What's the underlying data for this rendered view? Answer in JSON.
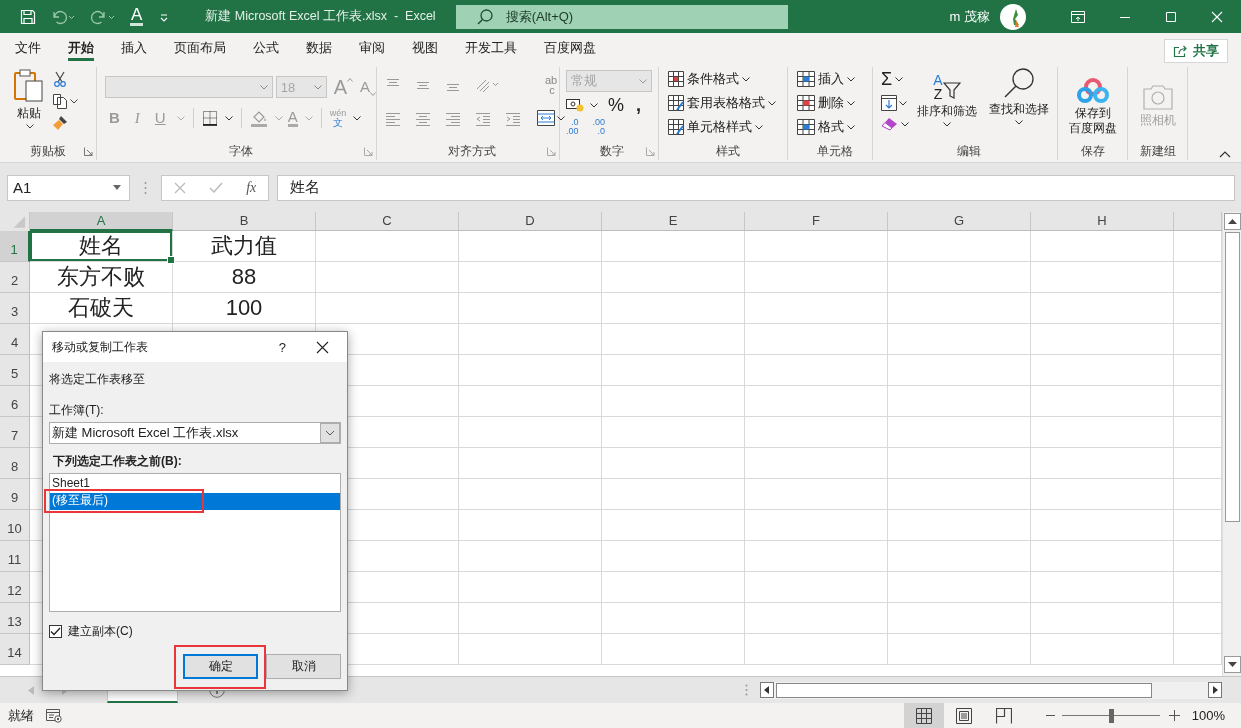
{
  "title_bar": {
    "font_color_glyph": "A",
    "title": "新建 Microsoft Excel 工作表.xlsx  -  Excel",
    "search": {
      "placeholder": "搜索(Alt+Q)"
    },
    "user_name": "m 茂稼"
  },
  "menu_tabs": [
    {
      "label": "文件",
      "selected": false
    },
    {
      "label": "开始",
      "selected": true
    },
    {
      "label": "插入",
      "selected": false
    },
    {
      "label": "页面布局",
      "selected": false
    },
    {
      "label": "公式",
      "selected": false
    },
    {
      "label": "数据",
      "selected": false
    },
    {
      "label": "审阅",
      "selected": false
    },
    {
      "label": "视图",
      "selected": false
    },
    {
      "label": "开发工具",
      "selected": false
    },
    {
      "label": "百度网盘",
      "selected": false
    }
  ],
  "share_button": "共享",
  "ribbon": {
    "clipboard": {
      "label": "剪贴板",
      "paste": "粘贴"
    },
    "font": {
      "label": "字体",
      "disabled": true,
      "font_size": "18",
      "grow_glyph": "A",
      "shrink_glyph": "A",
      "bold": "B",
      "italic": "I",
      "underline": "U",
      "color_glyph": "A",
      "phonetic": "wén",
      "phonetic_char": "文"
    },
    "alignment": {
      "label": "对齐方式",
      "wrap_glyphs": [
        "ab",
        "c"
      ]
    },
    "number": {
      "label": "数字",
      "format": "常规",
      "format_disabled": true,
      "percent": "%",
      "comma": ",",
      "increase_decimal": [
        ".0",
        ".00"
      ],
      "decrease_decimal": [
        ".00",
        ".0"
      ]
    },
    "styles": {
      "label": "样式",
      "items": [
        "条件格式",
        "套用表格格式",
        "单元格样式"
      ]
    },
    "cells": {
      "label": "单元格",
      "items": [
        "插入",
        "删除",
        "格式"
      ]
    },
    "editing": {
      "label": "编辑",
      "sum_glyph": "Σ",
      "sort_glyphs": [
        "A",
        "Z"
      ],
      "sort": "排序和筛选",
      "find": "查找和选择"
    },
    "save": {
      "label": "保存",
      "button_lines": [
        "保存到",
        "百度网盘"
      ]
    },
    "new_group": {
      "label": "新建组",
      "camera": "照相机",
      "disabled": true
    }
  },
  "formula_bar": {
    "name_box": "A1",
    "fx": "fx",
    "formula": "姓名"
  },
  "sheet": {
    "columns": [
      {
        "label": "A",
        "selected": true
      },
      {
        "label": "B",
        "selected": false
      },
      {
        "label": "C",
        "selected": false
      },
      {
        "label": "D",
        "selected": false
      },
      {
        "label": "E",
        "selected": false
      },
      {
        "label": "F",
        "selected": false
      },
      {
        "label": "G",
        "selected": false
      },
      {
        "label": "H",
        "selected": false
      }
    ],
    "rows": [
      {
        "number": "1",
        "selected": true,
        "cells": [
          "姓名",
          "武力值"
        ]
      },
      {
        "number": "2",
        "selected": false,
        "cells": [
          "东方不败",
          "88"
        ]
      },
      {
        "number": "3",
        "selected": false,
        "cells": [
          "石破天",
          "100"
        ]
      },
      {
        "number": "4",
        "selected": false
      },
      {
        "number": "5",
        "selected": false
      },
      {
        "number": "6",
        "selected": false
      },
      {
        "number": "7",
        "selected": false
      },
      {
        "number": "8",
        "selected": false
      },
      {
        "number": "9",
        "selected": false
      },
      {
        "number": "10",
        "selected": false
      },
      {
        "number": "11",
        "selected": false
      },
      {
        "number": "12",
        "selected": false
      },
      {
        "number": "13",
        "selected": false
      },
      {
        "number": "14",
        "selected": false
      }
    ]
  },
  "sheet_tabs": [
    {
      "selected": true
    }
  ],
  "status_bar": {
    "status": "就绪",
    "views": [
      {
        "kind": "normal",
        "selected": true
      },
      {
        "kind": "page_layout",
        "selected": false
      },
      {
        "kind": "page_break",
        "selected": false
      }
    ],
    "zoom": {
      "level": 0.5,
      "reading": "100%"
    }
  },
  "dialog": {
    "title": "移动或复制工作表",
    "help": "?",
    "heading": "将选定工作表移至",
    "workbook_label": "工作簿(T):",
    "workbook": "新建 Microsoft Excel 工作表.xlsx",
    "before_label": "下列选定工作表之前(B):",
    "sheets": [
      {
        "label": "Sheet1",
        "selected": false
      },
      {
        "label": "(移至最后)",
        "selected": true
      }
    ],
    "copy": {
      "label": "建立副本(C)",
      "checked": true
    },
    "buttons": [
      {
        "label": "确定",
        "default": true
      },
      {
        "label": "取消",
        "default": false
      }
    ]
  }
}
